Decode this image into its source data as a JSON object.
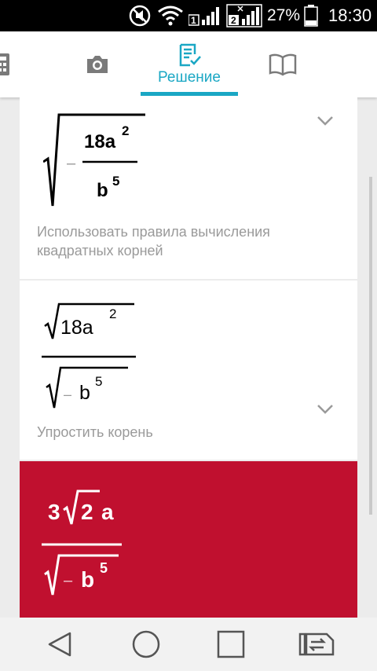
{
  "status_bar": {
    "battery": "27%",
    "time": "18:30",
    "sim1": "1",
    "sim2": "2"
  },
  "tabs": [
    {
      "icon": "calculator-icon",
      "label": ""
    },
    {
      "icon": "camera-icon",
      "label": ""
    },
    {
      "icon": "solution-icon",
      "label": "Решение",
      "active": true
    },
    {
      "icon": "book-icon",
      "label": ""
    }
  ],
  "steps": [
    {
      "expression": {
        "sign": "–",
        "numerator_base": "18a",
        "numerator_exp": "2",
        "denominator_base": "b",
        "denominator_exp": "5"
      },
      "description_line1": "Использовать правила вычисления",
      "description_line2": "квадратных корней"
    },
    {
      "expression": {
        "numerator_base": "18a",
        "numerator_exp": "2",
        "sign": "–",
        "denominator_base": "b",
        "denominator_exp": "5"
      },
      "description_line1": "Упростить корень"
    }
  ],
  "result": {
    "coefficient": "3",
    "radicand": "2",
    "variable": "a",
    "sign": "–",
    "denominator_base": "b",
    "denominator_exp": "5"
  },
  "colors": {
    "accent": "#1aa7c4",
    "result_background": "#c0102f"
  },
  "nav": [
    "back-icon",
    "home-icon",
    "recent-apps-icon",
    "switch-sim-icon"
  ]
}
